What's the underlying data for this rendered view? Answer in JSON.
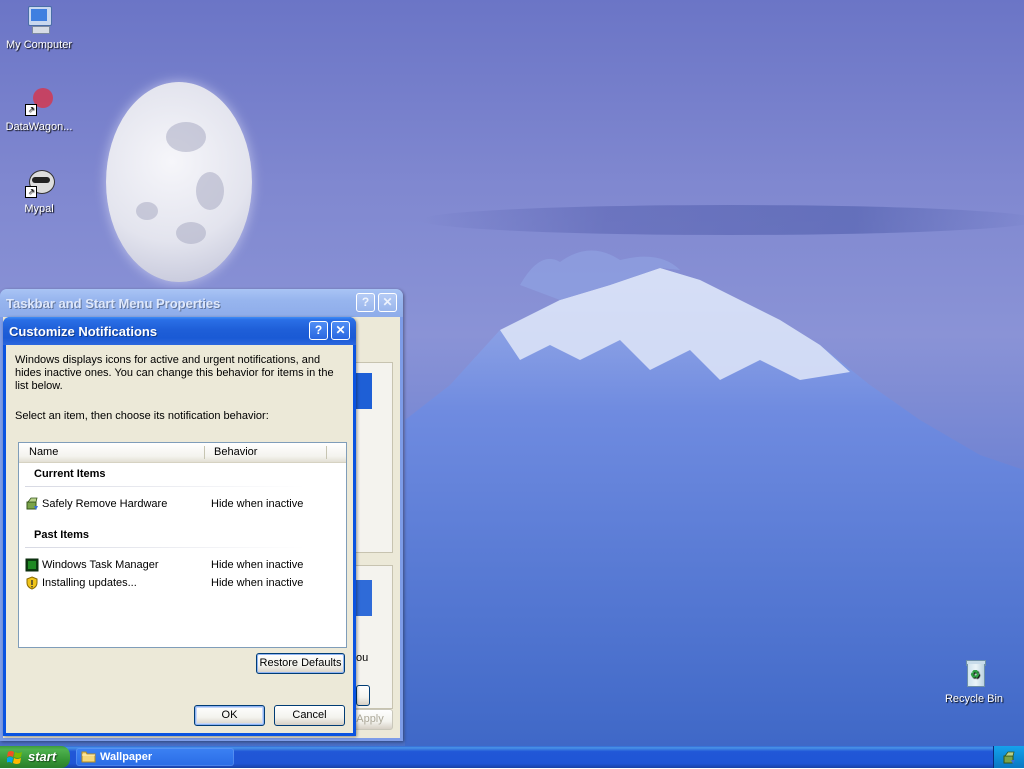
{
  "desktop": {
    "icons": [
      {
        "label": "My Computer"
      },
      {
        "label": "DataWagon..."
      },
      {
        "label": "Mypal"
      },
      {
        "label": "Recycle Bin"
      }
    ]
  },
  "taskbar_props": {
    "title": "Taskbar and Start Menu Properties",
    "help_label": "?",
    "close_label": "✕",
    "partial_text": "ou",
    "apply_label": "Apply"
  },
  "customize": {
    "title": "Customize Notifications",
    "help_label": "?",
    "close_label": "✕",
    "description": "Windows displays icons for active and urgent notifications, and hides inactive ones. You can change this behavior for items in the list below.",
    "instruction": "Select an item, then choose its notification behavior:",
    "columns": {
      "name": "Name",
      "behavior": "Behavior"
    },
    "groups": [
      {
        "title": "Current Items",
        "items": [
          {
            "name": "Safely Remove Hardware",
            "behavior": "Hide when inactive",
            "icon": "safely-remove-hardware-icon"
          }
        ]
      },
      {
        "title": "Past Items",
        "items": [
          {
            "name": "Windows Task Manager",
            "behavior": "Hide when inactive",
            "icon": "task-manager-icon"
          },
          {
            "name": "Installing updates...",
            "behavior": "Hide when inactive",
            "icon": "shield-icon"
          }
        ]
      }
    ],
    "restore_label": "Restore Defaults",
    "ok_label": "OK",
    "cancel_label": "Cancel"
  },
  "taskbar": {
    "start_label": "start",
    "window_button_label": "Wallpaper"
  },
  "colors": {
    "xp_title_blue": "#0a53e0",
    "dialog_face": "#ece9d8",
    "start_green": "#379837",
    "taskbar_blue": "#2055d5"
  }
}
